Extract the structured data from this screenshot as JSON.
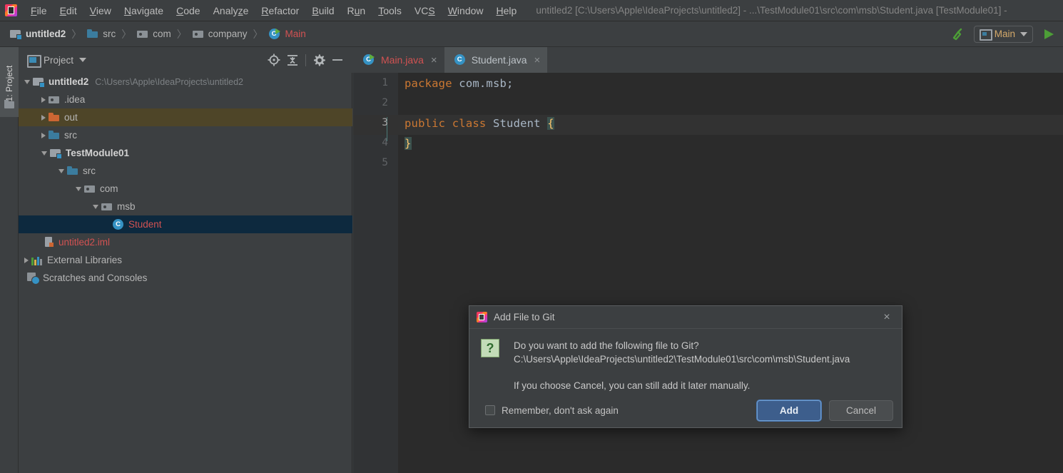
{
  "window": {
    "title": "untitled2 [C:\\Users\\Apple\\IdeaProjects\\untitled2] - ...\\TestModule01\\src\\com\\msb\\Student.java [TestModule01] -",
    "logo_icon": "intellij-idea-logo"
  },
  "menubar": {
    "items": [
      {
        "label": "File",
        "mnemonic": "F"
      },
      {
        "label": "Edit",
        "mnemonic": "E"
      },
      {
        "label": "View",
        "mnemonic": "V"
      },
      {
        "label": "Navigate",
        "mnemonic": "N"
      },
      {
        "label": "Code",
        "mnemonic": "C"
      },
      {
        "label": "Analyze",
        "mnemonic": "z"
      },
      {
        "label": "Refactor",
        "mnemonic": "R"
      },
      {
        "label": "Build",
        "mnemonic": "B"
      },
      {
        "label": "Run",
        "mnemonic": "u"
      },
      {
        "label": "Tools",
        "mnemonic": "T"
      },
      {
        "label": "VCS",
        "mnemonic": "S"
      },
      {
        "label": "Window",
        "mnemonic": "W"
      },
      {
        "label": "Help",
        "mnemonic": "H"
      }
    ]
  },
  "navbar": {
    "breadcrumbs": [
      {
        "label": "untitled2",
        "icon": "module-icon",
        "style": "bold"
      },
      {
        "label": "src",
        "icon": "source-folder-icon",
        "style": "normal"
      },
      {
        "label": "com",
        "icon": "package-folder-icon",
        "style": "normal"
      },
      {
        "label": "company",
        "icon": "package-folder-icon",
        "style": "normal"
      },
      {
        "label": "Main",
        "icon": "runnable-class-icon",
        "style": "accent"
      }
    ],
    "separator": "〉",
    "build_icon": "hammer-build-icon",
    "run_config": {
      "label": "Main",
      "icon": "application-icon",
      "caret": "chevron-down-icon"
    },
    "run_icon": "run-play-icon"
  },
  "toolstrip": {
    "project_tab_label": "1: Project",
    "folder_icon": "folder-icon"
  },
  "project_panel": {
    "header": {
      "title": "Project",
      "window_icon": "project-window-icon",
      "caret_icon": "chevron-down-icon",
      "actions": [
        {
          "name": "scroll-from-source-icon"
        },
        {
          "name": "collapse-all-icon"
        },
        {
          "name": "gear-settings-icon"
        },
        {
          "name": "hide-panel-icon"
        }
      ]
    },
    "tree": [
      {
        "label": "untitled2",
        "sublabel": "C:\\Users\\Apple\\IdeaProjects\\untitled2",
        "indent": 0,
        "arrow": "down",
        "icon": "module-icon",
        "style": "bold",
        "state": "normal"
      },
      {
        "label": ".idea",
        "sublabel": "",
        "indent": 1,
        "arrow": "right",
        "icon": "folder-gray-icon",
        "style": "normal",
        "state": "normal"
      },
      {
        "label": "out",
        "sublabel": "",
        "indent": 1,
        "arrow": "right",
        "icon": "folder-orange-icon",
        "style": "normal",
        "state": "hovered"
      },
      {
        "label": "src",
        "sublabel": "",
        "indent": 1,
        "arrow": "right",
        "icon": "source-folder-icon",
        "style": "normal",
        "state": "normal"
      },
      {
        "label": "TestModule01",
        "sublabel": "",
        "indent": 1,
        "arrow": "down",
        "icon": "module-icon",
        "style": "bold",
        "state": "normal"
      },
      {
        "label": "src",
        "sublabel": "",
        "indent": 2,
        "arrow": "down",
        "icon": "source-folder-icon",
        "style": "normal",
        "state": "normal"
      },
      {
        "label": "com",
        "sublabel": "",
        "indent": 3,
        "arrow": "down",
        "icon": "package-folder-icon",
        "style": "normal",
        "state": "normal"
      },
      {
        "label": "msb",
        "sublabel": "",
        "indent": 4,
        "arrow": "down",
        "icon": "package-folder-icon",
        "style": "normal",
        "state": "normal"
      },
      {
        "label": "Student",
        "sublabel": "",
        "indent": 5,
        "arrow": "none",
        "icon": "class-icon",
        "style": "red",
        "state": "selected"
      },
      {
        "label": "untitled2.iml",
        "sublabel": "",
        "indent": 1,
        "arrow": "none",
        "icon": "iml-file-icon",
        "style": "red",
        "state": "normal"
      },
      {
        "label": "External Libraries",
        "sublabel": "",
        "indent": 0,
        "arrow": "right",
        "icon": "libraries-icon",
        "style": "normal",
        "state": "normal"
      },
      {
        "label": "Scratches and Consoles",
        "sublabel": "",
        "indent": 0,
        "arrow": "none",
        "icon": "scratches-icon",
        "style": "normal",
        "state": "normal"
      }
    ]
  },
  "editor": {
    "tabs": [
      {
        "label": "Main.java",
        "icon": "runnable-class-icon",
        "style": "red",
        "active": false,
        "close": "×"
      },
      {
        "label": "Student.java",
        "icon": "class-icon",
        "style": "plain",
        "active": true,
        "close": "×"
      }
    ],
    "line_numbers": [
      "1",
      "2",
      "3",
      "4",
      "5"
    ],
    "caret_line": 3,
    "code_lines": [
      {
        "n": 1,
        "segments": [
          {
            "t": "package",
            "c": "kw"
          },
          {
            "t": " ",
            "c": "id"
          },
          {
            "t": "com.msb;",
            "c": "id"
          }
        ]
      },
      {
        "n": 2,
        "segments": []
      },
      {
        "n": 3,
        "segments": [
          {
            "t": "public",
            "c": "kw"
          },
          {
            "t": " ",
            "c": "id"
          },
          {
            "t": "class",
            "c": "kw"
          },
          {
            "t": " ",
            "c": "id"
          },
          {
            "t": "Student",
            "c": "cls"
          },
          {
            "t": " ",
            "c": "id"
          },
          {
            "t": "{",
            "c": "brace-hl"
          }
        ]
      },
      {
        "n": 4,
        "segments": [
          {
            "t": "}",
            "c": "brace-hl"
          }
        ]
      },
      {
        "n": 5,
        "segments": []
      }
    ]
  },
  "dialog": {
    "title": "Add File to Git",
    "title_icon": "intellij-idea-logo",
    "close_label": "×",
    "question_icon": "question-mark-icon",
    "message_line1": "Do you want to add the following file to Git?",
    "message_line2": "C:\\Users\\Apple\\IdeaProjects\\untitled2\\TestModule01\\src\\com\\msb\\Student.java",
    "note": "If you choose Cancel, you can still add it later manually.",
    "checkbox_label": "Remember, don't ask again",
    "checkbox_checked": false,
    "buttons": [
      {
        "label": "Add",
        "primary": true
      },
      {
        "label": "Cancel",
        "primary": false
      }
    ]
  },
  "colors": {
    "chrome_bg": "#3c3f41",
    "editor_bg": "#2b2b2b",
    "gutter_bg": "#313335",
    "selection_blue": "#0d293e",
    "hover_olive": "#4e4528",
    "accent_red": "#d25252",
    "keyword_orange": "#cc7832",
    "identifier_blue": "#a9b7c6",
    "primary_button": "#3d5e8c",
    "run_green": "#4d9e37"
  }
}
